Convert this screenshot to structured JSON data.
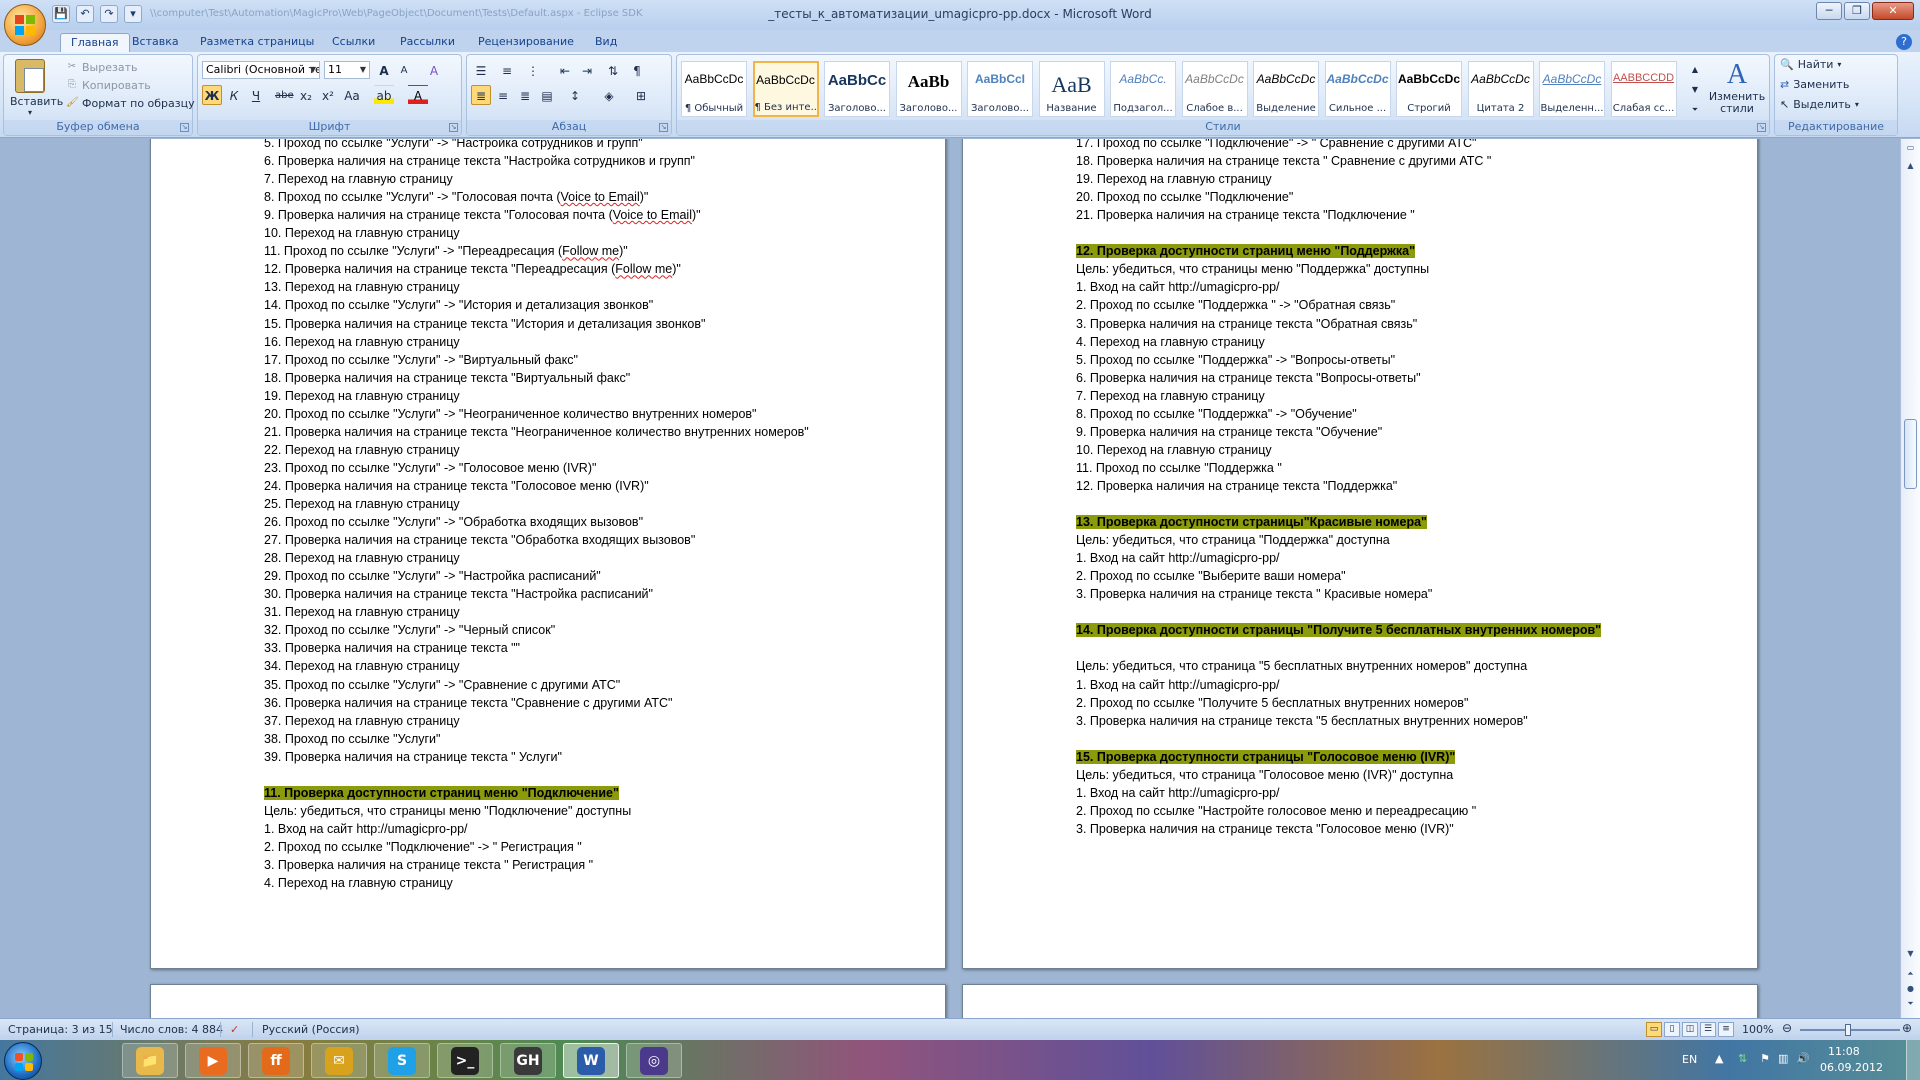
{
  "window": {
    "title": "_тесты_к_автоматизации_umagicpro-pp.docx - Microsoft Word",
    "path": "\\\\computer\\Test\\Automation\\MagicPro\\Web\\PageObject\\Document\\Tests\\Default.aspx - Eclipse SDK"
  },
  "quick_access": {
    "save": "💾",
    "undo": "↶",
    "redo": "↷",
    "more": "▾"
  },
  "window_controls": {
    "minimize": "─",
    "maximize": "❐",
    "close": "✕"
  },
  "tabs": [
    "Главная",
    "Вставка",
    "Разметка страницы",
    "Ссылки",
    "Рассылки",
    "Рецензирование",
    "Вид"
  ],
  "ribbon": {
    "clipboard": {
      "paste": "Вставить",
      "cut": "Вырезать",
      "copy": "Копировать",
      "format_painter": "Формат по образцу",
      "label": "Буфер обмена"
    },
    "font": {
      "family": "Calibri (Основной те",
      "size": "11",
      "grow": "A",
      "shrink": "A",
      "clear": "A",
      "bold": "Ж",
      "italic": "К",
      "underline": "Ч",
      "strike": "abe",
      "sub": "x₂",
      "sup": "x²",
      "case": "Aa",
      "highlight": "ab",
      "color": "A",
      "label": "Шрифт"
    },
    "paragraph": {
      "label": "Абзац"
    },
    "styles": {
      "label": "Стили",
      "items": [
        {
          "sample": "AaBbCcDc",
          "name": "¶ Обычный"
        },
        {
          "sample": "AaBbCcDc",
          "name": "¶ Без инте..."
        },
        {
          "sample": "AaBbCc",
          "name": "Заголово..."
        },
        {
          "sample": "AaBb",
          "name": "Заголово..."
        },
        {
          "sample": "AaBbCcI",
          "name": "Заголово..."
        },
        {
          "sample": "AaB",
          "name": "Название"
        },
        {
          "sample": "AaBbCc.",
          "name": "Подзагол..."
        },
        {
          "sample": "AaBbCcDc",
          "name": "Слабое в..."
        },
        {
          "sample": "AaBbCcDc",
          "name": "Выделение"
        },
        {
          "sample": "AaBbCcDc",
          "name": "Сильное ..."
        },
        {
          "sample": "AaBbCcDc",
          "name": "Строгий"
        },
        {
          "sample": "AaBbCcDc",
          "name": "Цитата 2"
        },
        {
          "sample": "AaBbCcDc",
          "name": "Выделенн..."
        },
        {
          "sample": "AABBCCDD",
          "name": "Слабая сс..."
        }
      ],
      "change": "Изменить стили"
    },
    "editing": {
      "find": "Найти",
      "replace": "Заменить",
      "select": "Выделить",
      "label": "Редактирование"
    }
  },
  "page_left": {
    "lines": [
      {
        "t": "5. Проход по ссылке \"Услуги\" -> \"Настройка сотрудников и групп\""
      },
      {
        "t": "6. Проверка наличия на странице текста \"Настройка сотрудников и групп\""
      },
      {
        "t": "7. Переход на главную страницу"
      },
      {
        "t": "8. Проход по ссылке \"Услуги\" -> \"Голосовая почта (Voice to Email)\""
      },
      {
        "t": "9. Проверка наличия на странице текста \"Голосовая почта (Voice to Email)\""
      },
      {
        "t": "10. Переход на главную страницу"
      },
      {
        "t": "11. Проход по ссылке \"Услуги\" -> \"Переадресация (Follow me)\""
      },
      {
        "t": "12. Проверка наличия на странице текста \"Переадресация (Follow me)\""
      },
      {
        "t": "13. Переход на главную страницу"
      },
      {
        "t": "14. Проход по ссылке \"Услуги\" -> \"История и детализация звонков\""
      },
      {
        "t": "15. Проверка наличия на странице текста \"История и детализация звонков\""
      },
      {
        "t": "16. Переход на главную страницу"
      },
      {
        "t": "17. Проход по ссылке \"Услуги\" -> \"Виртуальный факс\""
      },
      {
        "t": "18. Проверка наличия на странице текста \"Виртуальный факс\""
      },
      {
        "t": "19. Переход на главную страницу"
      },
      {
        "t": "20. Проход по ссылке \"Услуги\" -> \"Неограниченное количество внутренних номеров\""
      },
      {
        "t": "21. Проверка наличия на странице текста \"Неограниченное количество внутренних номеров\""
      },
      {
        "t": "22. Переход на главную страницу"
      },
      {
        "t": "23. Проход по ссылке \"Услуги\" -> \"Голосовое меню (IVR)\""
      },
      {
        "t": "24. Проверка наличия на странице текста \"Голосовое меню (IVR)\""
      },
      {
        "t": "25. Переход на главную страницу"
      },
      {
        "t": "26. Проход по ссылке \"Услуги\" -> \"Обработка входящих вызовов\""
      },
      {
        "t": "27. Проверка наличия на странице текста \"Обработка входящих вызовов\""
      },
      {
        "t": "28. Переход на главную страницу"
      },
      {
        "t": "29. Проход по ссылке \"Услуги\" -> \"Настройка расписаний\""
      },
      {
        "t": "30. Проверка наличия на странице текста \"Настройка расписаний\""
      },
      {
        "t": "31. Переход на главную страницу"
      },
      {
        "t": "32. Проход по ссылке \"Услуги\" -> \"Черный список\""
      },
      {
        "t": "33. Проверка наличия на странице текста \"\""
      },
      {
        "t": "34. Переход на главную страницу"
      },
      {
        "t": "35. Проход по ссылке \"Услуги\" -> \"Сравнение с другими АТС\""
      },
      {
        "t": "36. Проверка наличия на странице текста \"Сравнение с другими АТС\""
      },
      {
        "t": "37. Переход на главную страницу"
      },
      {
        "t": "38. Проход по ссылке \"Услуги\""
      },
      {
        "t": "39. Проверка наличия на странице текста \" Услуги\""
      },
      {
        "t": ""
      },
      {
        "t": "11. Проверка доступности страниц меню \"Подключение\"",
        "h": true
      },
      {
        "t": "Цель: убедиться, что страницы меню \"Подключение\" доступны"
      },
      {
        "t": "1. Вход на сайт http://umagicpro-pp/"
      },
      {
        "t": "2. Проход по ссылке \"Подключение\" -> \" Регистрация \""
      },
      {
        "t": "3. Проверка наличия на странице текста \" Регистрация \""
      },
      {
        "t": "4. Переход на главную страницу"
      }
    ]
  },
  "page_right": {
    "lines": [
      {
        "t": "17. Проход по ссылке \"Подключение\" -> \" Сравнение с другими АТС\""
      },
      {
        "t": "18. Проверка наличия на странице текста \" Сравнение с другими АТС \""
      },
      {
        "t": "19. Переход на главную страницу"
      },
      {
        "t": "20. Проход по ссылке \"Подключение\""
      },
      {
        "t": "21. Проверка наличия на странице текста \"Подключение \""
      },
      {
        "t": ""
      },
      {
        "t": "12. Проверка доступности страниц меню \"Поддержка\"",
        "h": true
      },
      {
        "t": "Цель: убедиться, что страницы меню \"Поддержка\" доступны"
      },
      {
        "t": "1. Вход на сайт http://umagicpro-pp/"
      },
      {
        "t": "2. Проход по ссылке \"Поддержка \" -> \"Обратная связь\""
      },
      {
        "t": "3. Проверка наличия на странице текста \"Обратная связь\""
      },
      {
        "t": "4. Переход на главную страницу"
      },
      {
        "t": "5. Проход по ссылке \"Поддержка\" -> \"Вопросы-ответы\""
      },
      {
        "t": "6. Проверка наличия на странице текста \"Вопросы-ответы\""
      },
      {
        "t": "7. Переход на главную страницу"
      },
      {
        "t": "8. Проход по ссылке \"Поддержка\" -> \"Обучение\""
      },
      {
        "t": "9. Проверка наличия на странице текста \"Обучение\""
      },
      {
        "t": "10. Переход на главную страницу"
      },
      {
        "t": "11. Проход по ссылке \"Поддержка \""
      },
      {
        "t": "12. Проверка наличия на странице текста \"Поддержка\""
      },
      {
        "t": ""
      },
      {
        "t": "13. Проверка доступности страницы\"Красивые номера\"",
        "h": true
      },
      {
        "t": "Цель: убедиться, что страница \"Поддержка\" доступна"
      },
      {
        "t": "1. Вход на сайт http://umagicpro-pp/"
      },
      {
        "t": "2. Проход по ссылке \"Выберите ваши номера\""
      },
      {
        "t": "3. Проверка наличия на странице текста \" Красивые номера\""
      },
      {
        "t": ""
      },
      {
        "t": "14. Проверка доступности страницы \"Получите 5 бесплатных внутренних номеров\"",
        "h": true
      },
      {
        "t": ""
      },
      {
        "t": "Цель: убедиться, что страница \"5 бесплатных внутренних номеров\" доступна"
      },
      {
        "t": "1. Вход на сайт http://umagicpro-pp/"
      },
      {
        "t": "2. Проход по ссылке \"Получите 5 бесплатных внутренних номеров\""
      },
      {
        "t": "3. Проверка наличия на странице текста \"5 бесплатных внутренних номеров\""
      },
      {
        "t": ""
      },
      {
        "t": "15. Проверка доступности страницы \"Голосовое меню (IVR)\"",
        "h": true
      },
      {
        "t": "Цель: убедиться, что страница \"Голосовое меню (IVR)\" доступна"
      },
      {
        "t": "1. Вход на сайт http://umagicpro-pp/"
      },
      {
        "t": "2. Проход по ссылке \"Настройте голосовое меню и переадресацию \""
      },
      {
        "t": "3. Проверка наличия на странице текста \"Голосовое меню (IVR)\""
      }
    ]
  },
  "status": {
    "page": "Страница: 3 из 15",
    "words": "Число слов: 4 884",
    "language": "Русский (Россия)",
    "zoom": "100%"
  },
  "taskbar": {
    "apps": [
      {
        "name": "explorer",
        "label": "📁",
        "color": "#e8b84a"
      },
      {
        "name": "media-player",
        "label": "▶",
        "color": "#e86b1f"
      },
      {
        "name": "firefox",
        "label": "ff",
        "color": "#e26a1a"
      },
      {
        "name": "mail",
        "label": "✉",
        "color": "#d9a21c"
      },
      {
        "name": "skype",
        "label": "S",
        "color": "#1ea1e6"
      },
      {
        "name": "terminal",
        "label": ">_",
        "color": "#222222"
      },
      {
        "name": "github",
        "label": "GH",
        "color": "#3a3a3a"
      },
      {
        "name": "word",
        "label": "W",
        "color": "#2b5caa"
      },
      {
        "name": "eclipse",
        "label": "◎",
        "color": "#4b3a8c"
      }
    ],
    "lang": "EN",
    "time": "11:08",
    "date": "06.09.2012"
  }
}
